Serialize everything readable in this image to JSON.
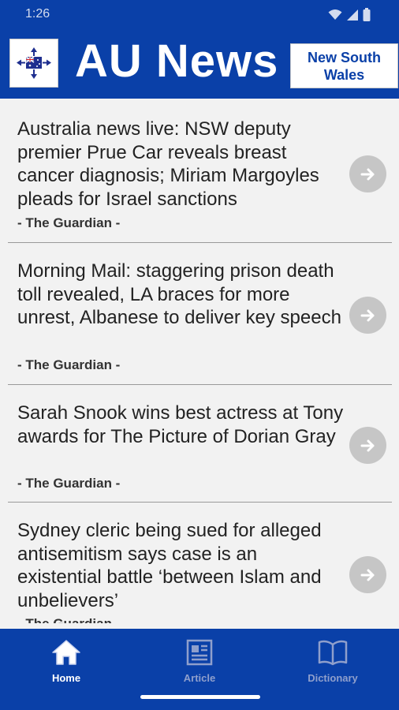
{
  "status_bar": {
    "time": "1:26",
    "icons": [
      "wifi-icon",
      "cellular-signal-icon",
      "battery-icon"
    ]
  },
  "header": {
    "title": "AU News",
    "region_button": "New South\nWales",
    "logo_icon": "australia-flag-logo",
    "background": "#0a40a8"
  },
  "news": [
    {
      "title": "Australia news live: NSW deputy premier Prue Car reveals breast cancer diagnosis; Miriam Margoyles pleads for Israel sanctions",
      "source": "- The Guardian -"
    },
    {
      "title": "Morning Mail: staggering prison death toll revealed, LA braces for more unrest, Albanese to deliver key speech",
      "source": "- The Guardian -"
    },
    {
      "title": "Sarah Snook wins best actress at Tony awards for The Picture of Dorian Gray",
      "source": "- The Guardian -"
    },
    {
      "title": "Sydney cleric being sued for alleged antisemitism says case is an existential battle ‘between Islam and unbelievers’",
      "source": "- The Guardian -"
    }
  ],
  "bottom_nav": {
    "items": [
      {
        "label": "Home",
        "icon": "home-icon",
        "active": true
      },
      {
        "label": "Article",
        "icon": "article-icon",
        "active": false
      },
      {
        "label": "Dictionary",
        "icon": "book-icon",
        "active": false
      }
    ]
  }
}
